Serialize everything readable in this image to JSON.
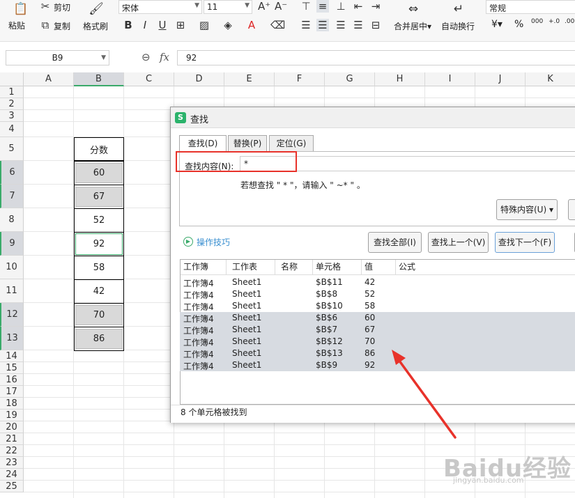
{
  "ribbon": {
    "paste": "粘贴",
    "cut": "剪切",
    "copy": "复制",
    "format_painter": "格式刷",
    "font_name": "宋体",
    "font_size": "11",
    "merge_center": "合并居中",
    "wrap_text": "自动换行",
    "number_format": "常规",
    "currency_symbol": "¥",
    "percent_symbol": "%"
  },
  "formula_bar": {
    "cell_ref": "B9",
    "fx": "fx",
    "value": "92"
  },
  "columns": [
    "A",
    "B",
    "C",
    "D",
    "E",
    "F",
    "G",
    "H",
    "I",
    "J",
    "K"
  ],
  "rows": [
    "1",
    "2",
    "3",
    "4",
    "5",
    "6",
    "7",
    "8",
    "9",
    "10",
    "11",
    "12",
    "13",
    "14",
    "15",
    "16",
    "17",
    "18",
    "19",
    "20",
    "21",
    "22",
    "23",
    "24",
    "25"
  ],
  "column_b": {
    "header": "分数",
    "values": [
      "60",
      "67",
      "52",
      "92",
      "58",
      "42",
      "70",
      "86"
    ]
  },
  "dialog": {
    "title": "查找",
    "tabs": [
      "查找(D)",
      "替换(P)",
      "定位(G)"
    ],
    "find_label": "查找内容(N):",
    "find_value": "*",
    "hint": "若想查找 \" * \"，请输入 \" ~* \" 。",
    "special_button": "特殊内容(U)",
    "tips_link": "操作技巧",
    "find_all": "查找全部(I)",
    "find_prev": "查找上一个(V)",
    "find_next": "查找下一个(F)",
    "list_headers": [
      "工作簿",
      "工作表",
      "名称",
      "单元格",
      "值",
      "公式"
    ],
    "results": [
      {
        "book": "工作簿4",
        "sheet": "Sheet1",
        "cell": "$B$11",
        "value": "42",
        "highlighted": false
      },
      {
        "book": "工作簿4",
        "sheet": "Sheet1",
        "cell": "$B$8",
        "value": "52",
        "highlighted": false
      },
      {
        "book": "工作簿4",
        "sheet": "Sheet1",
        "cell": "$B$10",
        "value": "58",
        "highlighted": false
      },
      {
        "book": "工作簿4",
        "sheet": "Sheet1",
        "cell": "$B$6",
        "value": "60",
        "highlighted": true
      },
      {
        "book": "工作簿4",
        "sheet": "Sheet1",
        "cell": "$B$7",
        "value": "67",
        "highlighted": true
      },
      {
        "book": "工作簿4",
        "sheet": "Sheet1",
        "cell": "$B$12",
        "value": "70",
        "highlighted": true
      },
      {
        "book": "工作簿4",
        "sheet": "Sheet1",
        "cell": "$B$13",
        "value": "86",
        "highlighted": true
      },
      {
        "book": "工作簿4",
        "sheet": "Sheet1",
        "cell": "$B$9",
        "value": "92",
        "highlighted": true
      }
    ],
    "status": "8 个单元格被找到"
  },
  "watermark": {
    "line1": "Baidu经验",
    "line2": "jingyan.baidu.com"
  },
  "colors": {
    "accent_green": "#3aaa6a",
    "annotation_red": "#e8322a",
    "selection_gray": "#d7dbe1"
  }
}
